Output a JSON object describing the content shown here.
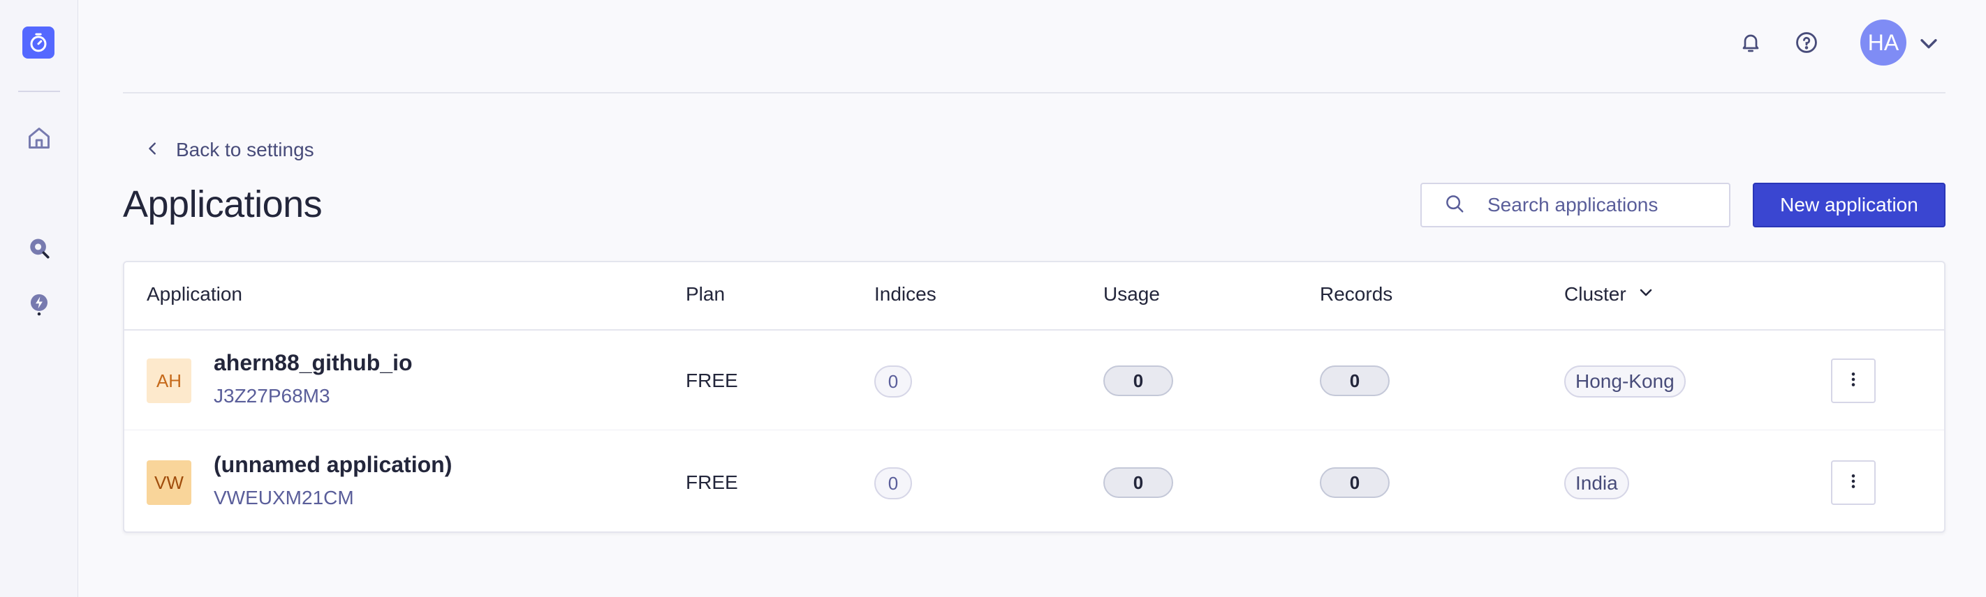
{
  "rail": {
    "icons": [
      "stopwatch-logo-icon",
      "home-icon",
      "search-insights-icon",
      "bolt-icon"
    ]
  },
  "topbar": {
    "icons": [
      "bell-icon",
      "help-icon",
      "chevron-down-icon"
    ],
    "avatar_initials": "HA"
  },
  "header": {
    "back_label": "Back to settings",
    "title": "Applications",
    "search_placeholder": "Search applications",
    "new_button_label": "New application"
  },
  "table": {
    "columns": {
      "application": "Application",
      "plan": "Plan",
      "indices": "Indices",
      "usage": "Usage",
      "records": "Records",
      "cluster": "Cluster"
    },
    "rows": [
      {
        "badge": "AH",
        "name": "ahern88_github_io",
        "app_id": "J3Z27P68M3",
        "plan": "FREE",
        "indices": "0",
        "usage": "0",
        "records": "0",
        "cluster": "Hong-Kong"
      },
      {
        "badge": "VW",
        "name": "(unnamed application)",
        "app_id": "VWEUXM21CM",
        "plan": "FREE",
        "indices": "0",
        "usage": "0",
        "records": "0",
        "cluster": "India"
      }
    ]
  },
  "colors": {
    "accent": "#3a46d1",
    "logo": "#5468ff",
    "badge_ah_bg": "#fde9cc",
    "badge_ah_text": "#c66a1b",
    "badge_vw_bg": "#f9d59a",
    "badge_vw_text": "#a04d0c"
  }
}
